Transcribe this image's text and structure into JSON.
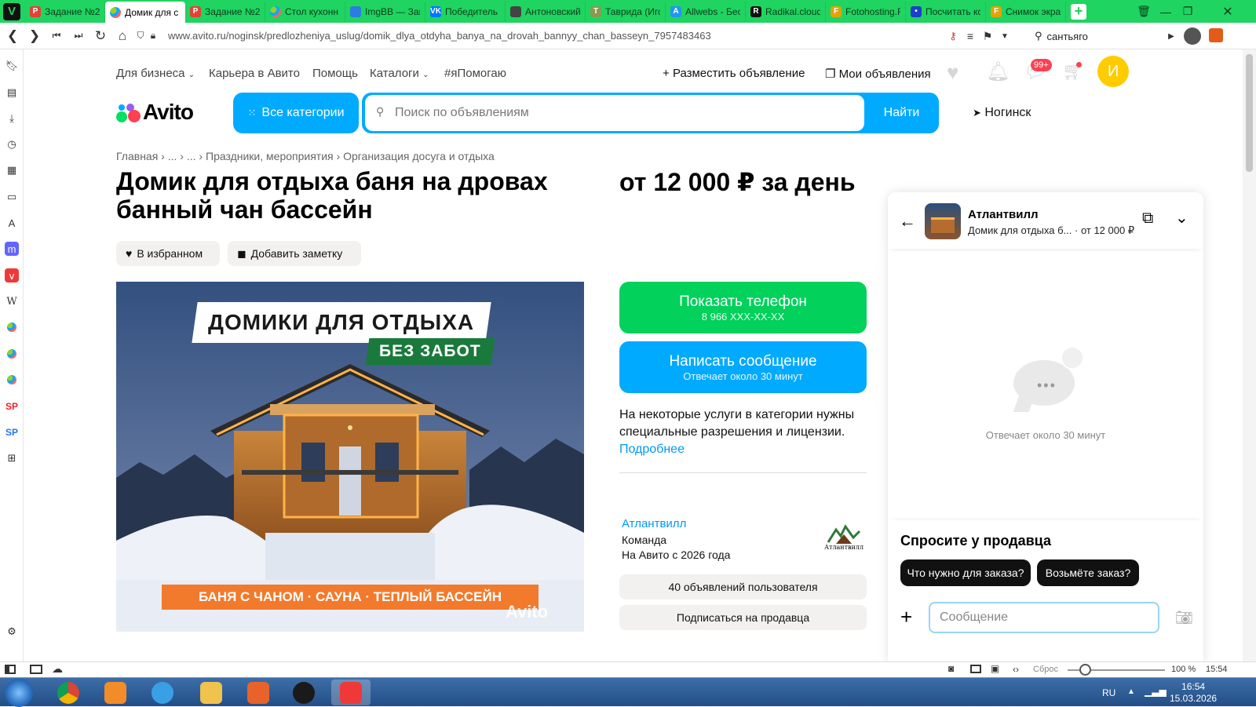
{
  "browser": {
    "tabs": [
      {
        "label": "Задание №2",
        "fav": "P",
        "color": "#e34234"
      },
      {
        "label": "Домик для с",
        "fav": "avito",
        "color": "#00aaff",
        "active": true
      },
      {
        "label": "Задание №2",
        "fav": "P",
        "color": "#e34234"
      },
      {
        "label": "Стол кухонн",
        "fav": "avito",
        "color": "#00aaff"
      },
      {
        "label": "ImgBB — Заг",
        "fav": "ibb",
        "color": "#2b7de1"
      },
      {
        "label": "Победитель",
        "fav": "VK",
        "color": "#0077ff"
      },
      {
        "label": "Антоновский",
        "fav": "LIB",
        "color": "#444"
      },
      {
        "label": "Таврида (Игс",
        "fav": "T",
        "color": "#8a9a50"
      },
      {
        "label": "Allwebs - Бес",
        "fav": "A",
        "color": "#2196f3"
      },
      {
        "label": "Radikal.cloud",
        "fav": "R",
        "color": "#111"
      },
      {
        "label": "Fotohosting.F",
        "fav": "F",
        "color": "#e4a300"
      },
      {
        "label": "Посчитать кс",
        "fav": "•",
        "color": "#1a3fc9"
      },
      {
        "label": "Снимок экра",
        "fav": "F",
        "color": "#e4a300"
      }
    ],
    "url_domain": "www.avito.ru",
    "url_path": "/noginsk/predlozheniya_uslug/domik_dlya_otdyha_banya_na_drovah_bannyy_chan_basseyn_7957483463",
    "search_engine_text": "сантьяго"
  },
  "header": {
    "top_links": [
      "Для бизнеса",
      "Карьера в Авито",
      "Помощь",
      "Каталоги",
      "#яПомогаю"
    ],
    "post_ad": "Разместить объявление",
    "my_ads": "Мои объявления",
    "notif_badge": "99+",
    "avatar_letter": "И",
    "logo": "Avito",
    "categories_button": "Все категории",
    "search_placeholder": "Поиск по объявлениям",
    "search_button": "Найти",
    "city": "Ногинск"
  },
  "breadcrumbs": [
    "Главная",
    "...",
    "...",
    "Праздники, мероприятия",
    "Организация досуга и отдыха"
  ],
  "listing": {
    "title": "Домик для отдыха баня на дровах банный чан бассейн",
    "price": "от 12 000 ₽ за день",
    "favorite_button": "В избранном",
    "note_button": "Добавить заметку",
    "photo": {
      "headline": "ДОМИКИ ДЛЯ ОТДЫХА",
      "subline": "БЕЗ ЗАБОТ",
      "banner": "БАНЯ С ЧАНОМ · САУНА · ТЕПЛЫЙ БАССЕЙН",
      "watermark": "Avito"
    },
    "phone_button": "Показать телефон",
    "phone_number": "8 966 XXX-XX-XX",
    "message_button": "Написать сообщение",
    "message_sub": "Отвечает около 30 минут",
    "notice": "На некоторые услуги в категории нужны специальные разрешения и лицензии.",
    "notice_link": "Подробнее"
  },
  "seller": {
    "name": "Атлантвилл",
    "type": "Команда",
    "since": "На Авито с 2026 года",
    "logo_text": "Атлантвилл",
    "ads_count": "40 объявлений пользователя",
    "subscribe": "Подписаться на продавца"
  },
  "chat": {
    "name": "Атлантвилл",
    "subtitle_title": "Домик для отдыха б...",
    "subtitle_price": "· от 12 000 ₽",
    "reply_time": "Отвечает около 30 минут",
    "ask_title": "Спросите у продавца",
    "quick_questions": [
      "Что нужно для заказа?",
      "Возьмёте заказ?"
    ],
    "message_placeholder": "Сообщение"
  },
  "statusbar": {
    "reset": "Сброс",
    "zoom": "100 %",
    "time": "15:54"
  },
  "taskbar": {
    "lang": "RU",
    "time": "16:54",
    "date": "15.03.2026"
  }
}
